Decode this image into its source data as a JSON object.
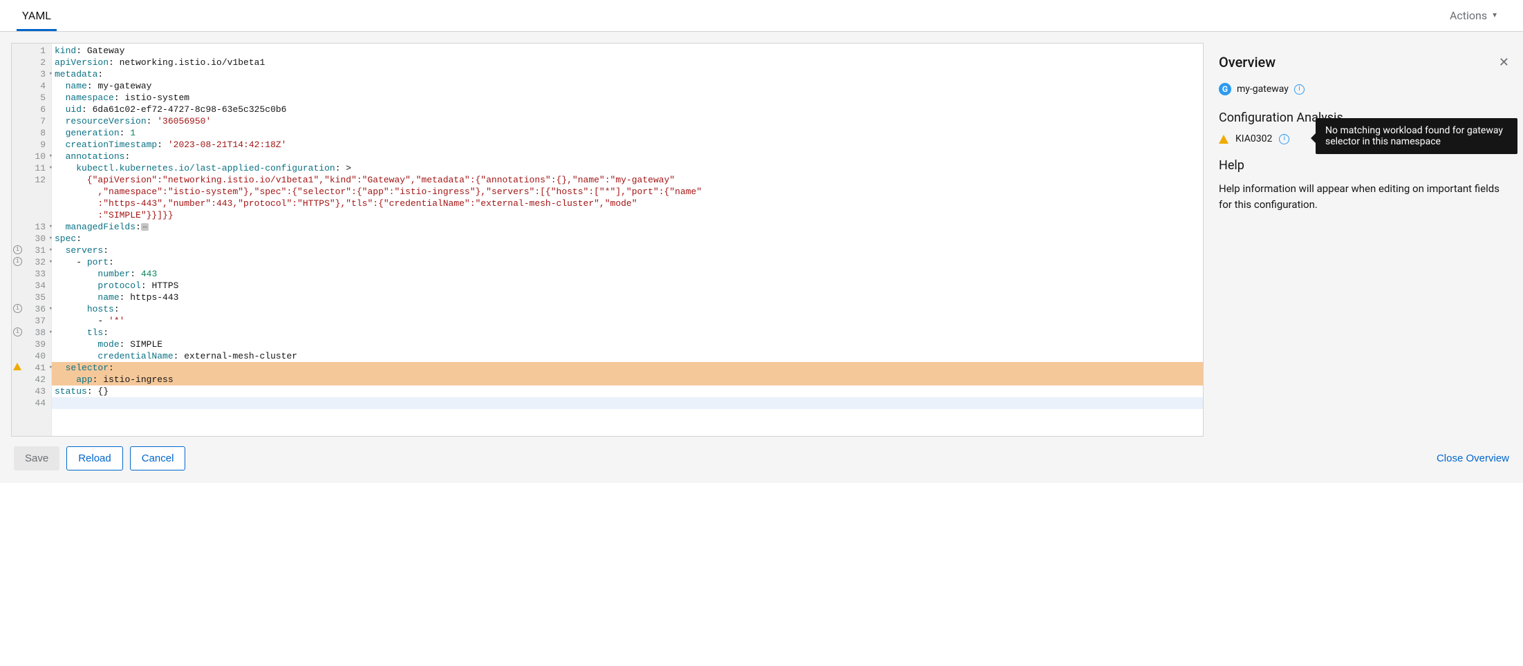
{
  "topbar": {
    "tab": "YAML",
    "actions": "Actions"
  },
  "editor": {
    "lines": [
      {
        "n": "1",
        "segs": [
          {
            "t": "kind",
            "c": "key"
          },
          {
            "t": ": ",
            "c": "plain"
          },
          {
            "t": "Gateway",
            "c": "plain"
          }
        ]
      },
      {
        "n": "2",
        "segs": [
          {
            "t": "apiVersion",
            "c": "key"
          },
          {
            "t": ": ",
            "c": "plain"
          },
          {
            "t": "networking.istio.io/v1beta1",
            "c": "plain"
          }
        ]
      },
      {
        "n": "3",
        "fold": true,
        "segs": [
          {
            "t": "metadata",
            "c": "key"
          },
          {
            "t": ":",
            "c": "plain"
          }
        ]
      },
      {
        "n": "4",
        "segs": [
          {
            "t": "  ",
            "c": "plain"
          },
          {
            "t": "name",
            "c": "key"
          },
          {
            "t": ": ",
            "c": "plain"
          },
          {
            "t": "my-gateway",
            "c": "plain"
          }
        ]
      },
      {
        "n": "5",
        "segs": [
          {
            "t": "  ",
            "c": "plain"
          },
          {
            "t": "namespace",
            "c": "key"
          },
          {
            "t": ": ",
            "c": "plain"
          },
          {
            "t": "istio-system",
            "c": "plain"
          }
        ]
      },
      {
        "n": "6",
        "segs": [
          {
            "t": "  ",
            "c": "plain"
          },
          {
            "t": "uid",
            "c": "key"
          },
          {
            "t": ": ",
            "c": "plain"
          },
          {
            "t": "6da61c02-ef72-4727-8c98-63e5c325c0b6",
            "c": "plain"
          }
        ]
      },
      {
        "n": "7",
        "segs": [
          {
            "t": "  ",
            "c": "plain"
          },
          {
            "t": "resourceVersion",
            "c": "key"
          },
          {
            "t": ": ",
            "c": "plain"
          },
          {
            "t": "'36056950'",
            "c": "string"
          }
        ]
      },
      {
        "n": "8",
        "segs": [
          {
            "t": "  ",
            "c": "plain"
          },
          {
            "t": "generation",
            "c": "key"
          },
          {
            "t": ": ",
            "c": "plain"
          },
          {
            "t": "1",
            "c": "num"
          }
        ]
      },
      {
        "n": "9",
        "segs": [
          {
            "t": "  ",
            "c": "plain"
          },
          {
            "t": "creationTimestamp",
            "c": "key"
          },
          {
            "t": ": ",
            "c": "plain"
          },
          {
            "t": "'2023-08-21T14:42:18Z'",
            "c": "string"
          }
        ]
      },
      {
        "n": "10",
        "fold": true,
        "segs": [
          {
            "t": "  ",
            "c": "plain"
          },
          {
            "t": "annotations",
            "c": "key"
          },
          {
            "t": ":",
            "c": "plain"
          }
        ]
      },
      {
        "n": "11",
        "fold": true,
        "segs": [
          {
            "t": "    ",
            "c": "plain"
          },
          {
            "t": "kubectl.kubernetes.io/last-applied-configuration",
            "c": "key"
          },
          {
            "t": ": >",
            "c": "plain"
          }
        ]
      },
      {
        "n": "12",
        "segs": [
          {
            "t": "      {\"apiVersion\":\"networking.istio.io/v1beta1\",\"kind\":\"Gateway\",\"metadata\":{\"annotations\":{},\"name\":\"my-gateway\"",
            "c": "string"
          }
        ]
      },
      {
        "n": "",
        "segs": [
          {
            "t": "        ,\"namespace\":\"istio-system\"},\"spec\":{\"selector\":{\"app\":\"istio-ingress\"},\"servers\":[{\"hosts\":[\"*\"],\"port\":{\"name\"",
            "c": "string"
          }
        ]
      },
      {
        "n": "",
        "segs": [
          {
            "t": "        :\"https-443\",\"number\":443,\"protocol\":\"HTTPS\"},\"tls\":{\"credentialName\":\"external-mesh-cluster\",\"mode\"",
            "c": "string"
          }
        ]
      },
      {
        "n": "",
        "segs": [
          {
            "t": "        :\"SIMPLE\"}}]}}",
            "c": "string"
          }
        ]
      },
      {
        "n": "13",
        "fold": true,
        "segs": [
          {
            "t": "  ",
            "c": "plain"
          },
          {
            "t": "managedFields",
            "c": "key"
          },
          {
            "t": ":",
            "c": "plain"
          }
        ],
        "collapsed": true
      },
      {
        "n": "30",
        "fold": true,
        "segs": [
          {
            "t": "spec",
            "c": "key"
          },
          {
            "t": ":",
            "c": "plain"
          }
        ]
      },
      {
        "n": "31",
        "fold": true,
        "info": true,
        "segs": [
          {
            "t": "  ",
            "c": "plain"
          },
          {
            "t": "servers",
            "c": "key"
          },
          {
            "t": ":",
            "c": "plain"
          }
        ]
      },
      {
        "n": "32",
        "fold": true,
        "info": true,
        "segs": [
          {
            "t": "    - ",
            "c": "plain"
          },
          {
            "t": "port",
            "c": "key"
          },
          {
            "t": ":",
            "c": "plain"
          }
        ]
      },
      {
        "n": "33",
        "segs": [
          {
            "t": "        ",
            "c": "plain"
          },
          {
            "t": "number",
            "c": "key"
          },
          {
            "t": ": ",
            "c": "plain"
          },
          {
            "t": "443",
            "c": "num"
          }
        ]
      },
      {
        "n": "34",
        "segs": [
          {
            "t": "        ",
            "c": "plain"
          },
          {
            "t": "protocol",
            "c": "key"
          },
          {
            "t": ": ",
            "c": "plain"
          },
          {
            "t": "HTTPS",
            "c": "plain"
          }
        ]
      },
      {
        "n": "35",
        "segs": [
          {
            "t": "        ",
            "c": "plain"
          },
          {
            "t": "name",
            "c": "key"
          },
          {
            "t": ": ",
            "c": "plain"
          },
          {
            "t": "https-443",
            "c": "plain"
          }
        ]
      },
      {
        "n": "36",
        "fold": true,
        "info": true,
        "segs": [
          {
            "t": "      ",
            "c": "plain"
          },
          {
            "t": "hosts",
            "c": "key"
          },
          {
            "t": ":",
            "c": "plain"
          }
        ]
      },
      {
        "n": "37",
        "segs": [
          {
            "t": "        - ",
            "c": "plain"
          },
          {
            "t": "'*'",
            "c": "string"
          }
        ]
      },
      {
        "n": "38",
        "fold": true,
        "info": true,
        "segs": [
          {
            "t": "      ",
            "c": "plain"
          },
          {
            "t": "tls",
            "c": "key"
          },
          {
            "t": ":",
            "c": "plain"
          }
        ]
      },
      {
        "n": "39",
        "segs": [
          {
            "t": "        ",
            "c": "plain"
          },
          {
            "t": "mode",
            "c": "key"
          },
          {
            "t": ": ",
            "c": "plain"
          },
          {
            "t": "SIMPLE",
            "c": "plain"
          }
        ]
      },
      {
        "n": "40",
        "segs": [
          {
            "t": "        ",
            "c": "plain"
          },
          {
            "t": "credentialName",
            "c": "key"
          },
          {
            "t": ": ",
            "c": "plain"
          },
          {
            "t": "external-mesh-cluster",
            "c": "plain"
          }
        ]
      },
      {
        "n": "41",
        "fold": true,
        "warn": true,
        "hl": "warn",
        "segs": [
          {
            "t": "  ",
            "c": "plain"
          },
          {
            "t": "selector",
            "c": "key"
          },
          {
            "t": ":",
            "c": "plain"
          }
        ]
      },
      {
        "n": "42",
        "hl": "warn",
        "segs": [
          {
            "t": "    ",
            "c": "plain"
          },
          {
            "t": "app",
            "c": "key"
          },
          {
            "t": ": ",
            "c": "plain"
          },
          {
            "t": "istio-ingress",
            "c": "plain"
          }
        ]
      },
      {
        "n": "43",
        "segs": [
          {
            "t": "status",
            "c": "key"
          },
          {
            "t": ": {}",
            "c": "plain"
          }
        ]
      },
      {
        "n": "44",
        "hl": "cursor",
        "segs": [
          {
            "t": "",
            "c": "plain"
          }
        ]
      }
    ]
  },
  "overview": {
    "title": "Overview",
    "resource_badge": "G",
    "resource_name": "my-gateway",
    "config_title": "Configuration Analysis",
    "analysis_code": "KIA0302",
    "tooltip": "No matching workload found for gateway selector in this namespace",
    "help_title": "Help",
    "help_text": "Help information will appear when editing on important fields for this configuration."
  },
  "footer": {
    "save": "Save",
    "reload": "Reload",
    "cancel": "Cancel",
    "close": "Close Overview"
  }
}
